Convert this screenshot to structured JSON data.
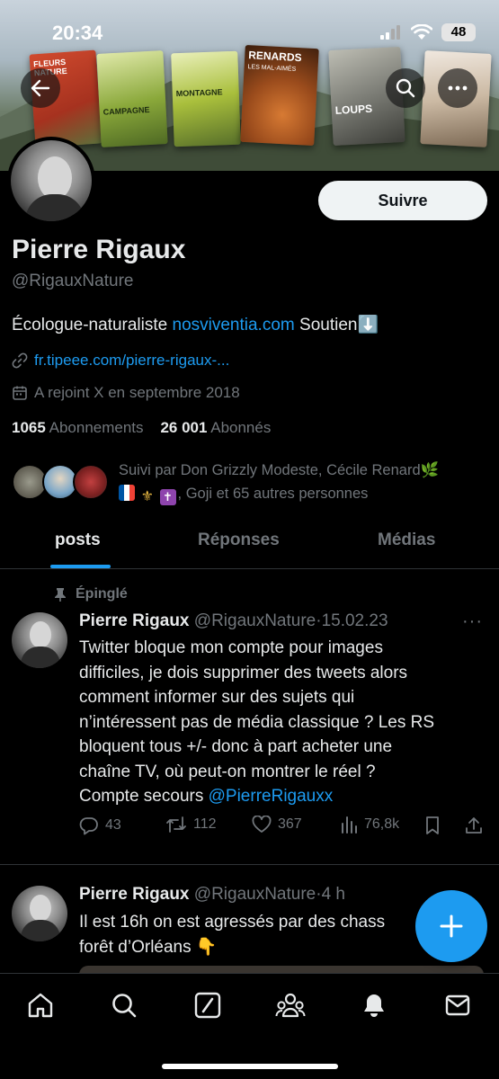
{
  "status_bar": {
    "time": "20:34",
    "battery": "48"
  },
  "banner": {
    "books": [
      {
        "title": "FLEURS NATURE",
        "color": "#c0392b"
      },
      {
        "title": "CAMPAGNE",
        "color": "#8aa83a"
      },
      {
        "title": "MONTAGNE",
        "color": "#a9bf3c"
      },
      {
        "title": "RENARDS",
        "subtitle": "LES MAL-AIMÉS",
        "color": "#b5642a"
      },
      {
        "title": "LOUPS",
        "color": "#8d8f8a"
      },
      {
        "title": "",
        "color": "#d9d1c4"
      }
    ]
  },
  "profile": {
    "follow_label": "Suivre",
    "name": "Pierre Rigaux",
    "handle": "@RigauxNature",
    "bio_text": "Écologue-naturaliste",
    "bio_link": "nosviventia.com",
    "bio_suffix": "Soutien⬇️",
    "website": "fr.tipeee.com/pierre-rigaux-...",
    "joined": "A rejoint X en septembre 2018",
    "following_count": "1065",
    "following_label": "Abonnements",
    "followers_count": "26 001",
    "followers_label": "Abonnés",
    "followed_by_line1": "Suivi par Don Grizzly Modeste, Cécile Renard🌿",
    "followed_by_line2": ", Goji et 65 autres personnes"
  },
  "tabs": [
    {
      "label": "posts",
      "active": true
    },
    {
      "label": "Réponses",
      "active": false
    },
    {
      "label": "Médias",
      "active": false
    }
  ],
  "tweets": [
    {
      "pinned_label": "Épinglé",
      "name": "Pierre Rigaux",
      "handle": "@RigauxNature",
      "date": "15.02.23",
      "text_lines": [
        "Twitter bloque mon compte pour images",
        "difficiles, je dois supprimer des tweets alors",
        "comment informer sur des sujets qui",
        "n’intéressent pas de média classique ? Les RS",
        "bloquent tous +/- donc à part acheter une",
        "chaîne TV, où peut-on montrer le réel ?"
      ],
      "last_line_prefix": "Compte secours",
      "last_line_mention": "@PierreRigauxx",
      "replies": "43",
      "retweets": "112",
      "likes": "367",
      "views": "76,8k"
    },
    {
      "name": "Pierre Rigaux",
      "handle": "@RigauxNature",
      "date": "4 h",
      "text_lines": [
        "Il est 16h on est agressés par des chass",
        "forêt d’Orléans 👇"
      ]
    }
  ]
}
